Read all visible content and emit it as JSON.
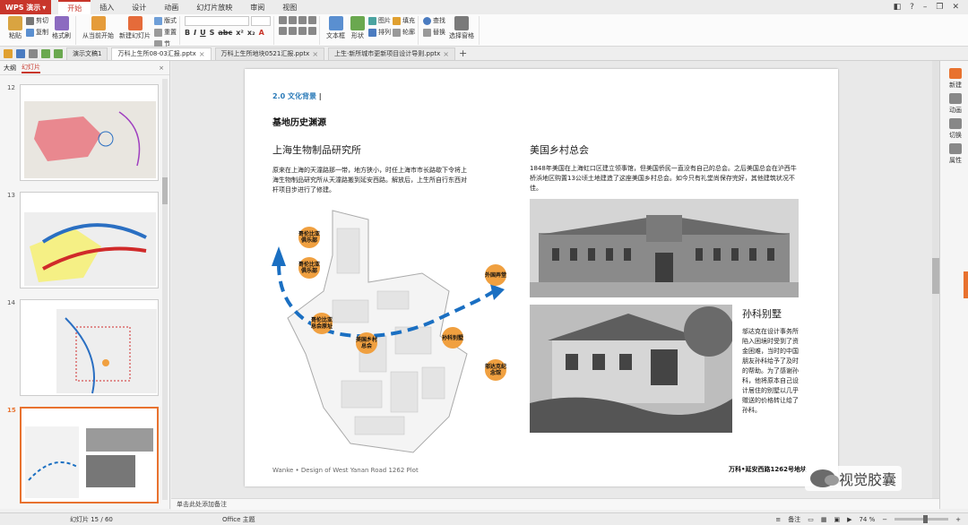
{
  "titlebar": {
    "app_name": "WPS 演示",
    "menu_tabs": [
      "开始",
      "插入",
      "设计",
      "动画",
      "幻灯片放映",
      "审阅",
      "视图"
    ],
    "active_tab": "开始"
  },
  "ribbon": {
    "paste": "粘贴",
    "cut": "剪切",
    "copy": "复制",
    "format_painter": "格式刷",
    "from_current": "从当前开始",
    "new_slide": "新建幻灯片",
    "layout": "版式",
    "reset": "重置",
    "section": "节",
    "text_box": "文本框",
    "shape": "形状",
    "picture": "图片",
    "fill": "填充",
    "arrange": "排列",
    "outline": "轮廓",
    "find": "查找",
    "replace": "替换",
    "select_pane": "选择窗格"
  },
  "doc_tabs": [
    {
      "label": "演示文稿1",
      "active": false
    },
    {
      "label": "万科上生所08-03汇报.pptx",
      "active": true
    },
    {
      "label": "万科上生所地块0521汇报.pptx",
      "active": false
    },
    {
      "label": "上生·新所城市更新项目设计导则.pptx",
      "active": false
    }
  ],
  "left_panel": {
    "tabs": [
      "大纲",
      "幻灯片"
    ],
    "active_tab": "幻灯片",
    "slide_numbers": [
      "12",
      "13",
      "14",
      "15"
    ],
    "selected": "15"
  },
  "slide": {
    "section": "2.0  文化背景",
    "title": "基地历史渊源",
    "left_heading": "上海生物制品研究所",
    "left_paragraph": "原来在上海的天潼路那一带，地方狭小，时任上海市市长路歇下令将上海生物制品研究所从天潼路搬到延安西路。解放后，上生所自行东西对杆项目步进行了修建。",
    "right_heading": "美国乡村总会",
    "right_paragraph": "1848年美国在上海虹口区建立领事馆，但美国侨民一直没有自己的总会。之后美国总会在沪西牛桥浜地区购置13公顷土地建造了这座美国乡村总会。如今只有礼堂尚保存完好，其他建筑状况不佳。",
    "sun_heading": "孙科别墅",
    "sun_paragraph": "邬达克在设计事务所陷入困境时受到了资金困难，当时的中国朋友孙科给予了及时的帮助。为了感谢孙科，他将原本自己设计居住的别墅以几乎赠送的价格转让给了孙科。",
    "map_tags": [
      "哥伦比亚俱乐部",
      "哥伦比亚俱乐部",
      "哥伦比亚总会原址",
      "美国乡村总会",
      "孙科别墅",
      "外国弄堂",
      "邬达克纪念馆"
    ],
    "footer_left": "Wanke • Design of West Yanan Road 1262 Plot",
    "footer_right": "万科•延安西路1262号地块"
  },
  "right_panel": {
    "items": [
      "新建",
      "动画",
      "切换",
      "属性"
    ]
  },
  "notes": "单击此处添加备注",
  "status": {
    "slide_counter": "幻灯片 15 / 60",
    "theme": "Office 主题",
    "notes_label": "备注",
    "zoom": "74 %"
  },
  "watermark": "视觉胶囊",
  "colors": {
    "accent": "#c8362b",
    "selection": "#e8722f",
    "section_blue": "#2a7ab8",
    "route_blue": "#1a6fc2",
    "tag_orange": "#f0a040"
  }
}
